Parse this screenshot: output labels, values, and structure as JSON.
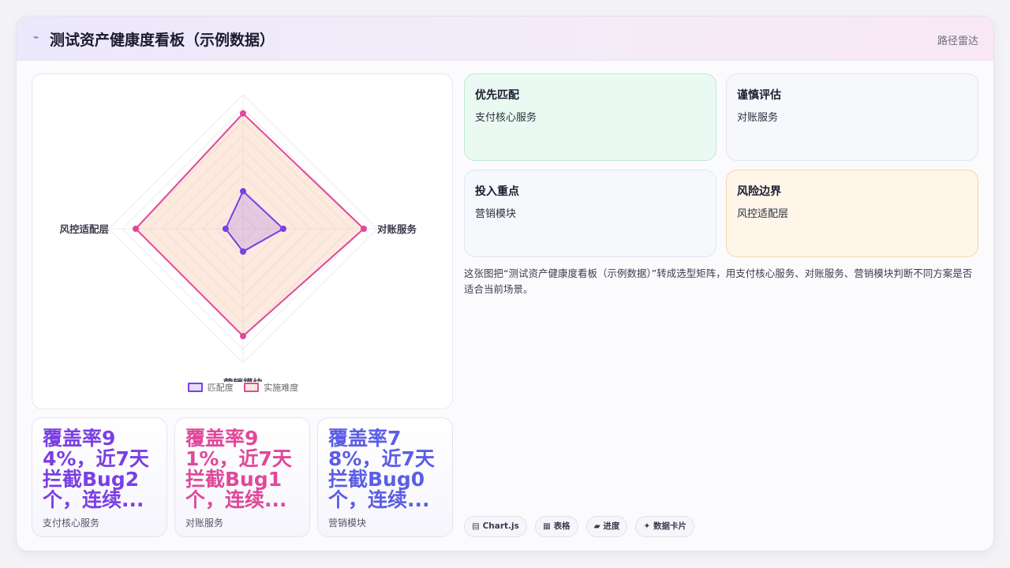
{
  "header": {
    "logo_icon": "⌁",
    "title": "测试资产健康度看板（示例数据）",
    "right_link": "路径雷达"
  },
  "chart_data": {
    "type": "radar",
    "axes": [
      "支付核心服务",
      "对账服务",
      "营销模块",
      "风控适配层"
    ],
    "series": [
      {
        "name": "匹配度",
        "values": [
          28,
          30,
          17,
          13
        ],
        "color": "#7b3fe4",
        "fill": "rgba(123,63,228,0.18)"
      },
      {
        "name": "实施难度",
        "values": [
          86,
          90,
          80,
          80
        ],
        "color": "#e0489a",
        "fill": "rgba(247,180,140,0.28)"
      }
    ],
    "r_range": [
      0,
      100
    ],
    "grid": true,
    "legend_position": "bottom"
  },
  "stats": [
    {
      "value": "覆盖率94%，近7天拦截Bug2个，连续...",
      "label": "支付核心服务",
      "color": "#7b3fe4"
    },
    {
      "value": "覆盖率91%，近7天拦截Bug1个，连续...",
      "label": "对账服务",
      "color": "#e0489a"
    },
    {
      "value": "覆盖率78%，近7天拦截Bug0个，连续...",
      "label": "营销模块",
      "color": "#5b5ee6"
    }
  ],
  "tiles": [
    {
      "title": "优先匹配",
      "value": "支付核心服务"
    },
    {
      "title": "谨慎评估",
      "value": "对账服务"
    },
    {
      "title": "投入重点",
      "value": "营销模块"
    },
    {
      "title": "风险边界",
      "value": "风控适配层"
    }
  ],
  "description": "这张图把“测试资产健康度看板（示例数据）”转成选型矩阵，用支付核心服务、对账服务、营销模块判断不同方案是否适合当前场景。",
  "badges": [
    {
      "icon": "▤",
      "label": "Chart.js"
    },
    {
      "icon": "▦",
      "label": "表格"
    },
    {
      "icon": "▰",
      "label": "进度"
    },
    {
      "icon": "✦",
      "label": "数据卡片"
    }
  ]
}
